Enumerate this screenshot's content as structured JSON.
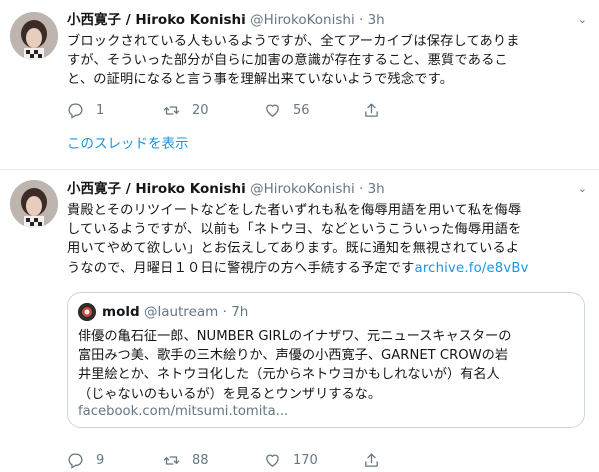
{
  "tweets": [
    {
      "name": "小西寛子 / Hiroko Konishi",
      "handle": "@HirokoKonishi",
      "time": "3h",
      "text_lines": [
        "ブロックされている人もいるようですが、全てアーカイブは保存してありま",
        "すが、そういった部分が自らに加害の意識が存在すること、悪質であるこ",
        "と、の証明になると言う事を理解出来ていないようで残念です。"
      ],
      "replies": "1",
      "retweets": "20",
      "likes": "56",
      "thread_link": "このスレッドを表示"
    },
    {
      "name": "小西寛子 / Hiroko Konishi",
      "handle": "@HirokoKonishi",
      "time": "3h",
      "text_lines": [
        "貴殿とそのリツイートなどをした者いずれも私を侮辱用語を用いて私を侮辱",
        "しているようですが、以前も「ネトウヨ、などというこういった侮辱用語を",
        "用いてやめて欲しい」とお伝えしてあります。既に通知を無視されているよ",
        "うなので、月曜日１０日に警視庁の方へ手続する予定です"
      ],
      "link_text": "archive.fo/e8vBv",
      "replies": "9",
      "retweets": "88",
      "likes": "170",
      "quote": {
        "name": "mold",
        "handle": "@lautream",
        "time": "7h",
        "text_lines": [
          "俳優の亀石征一郎、NUMBER GIRLのイナザワ、元ニュースキャスターの",
          "富田みつ美、歌手の三木絵りか、声優の小西寛子、GARNET CROWの岩",
          "井里絵とか、ネトウヨ化した（元からネトウヨかもしれないが）有名人",
          "（じゃないのもいるが）を見るとウンザリするな。"
        ],
        "link": "facebook.com/mitsumi.tomita..."
      }
    }
  ],
  "colors": {
    "accent": "#1b95e0",
    "muted": "#657786",
    "border": "#ccd6dd"
  }
}
